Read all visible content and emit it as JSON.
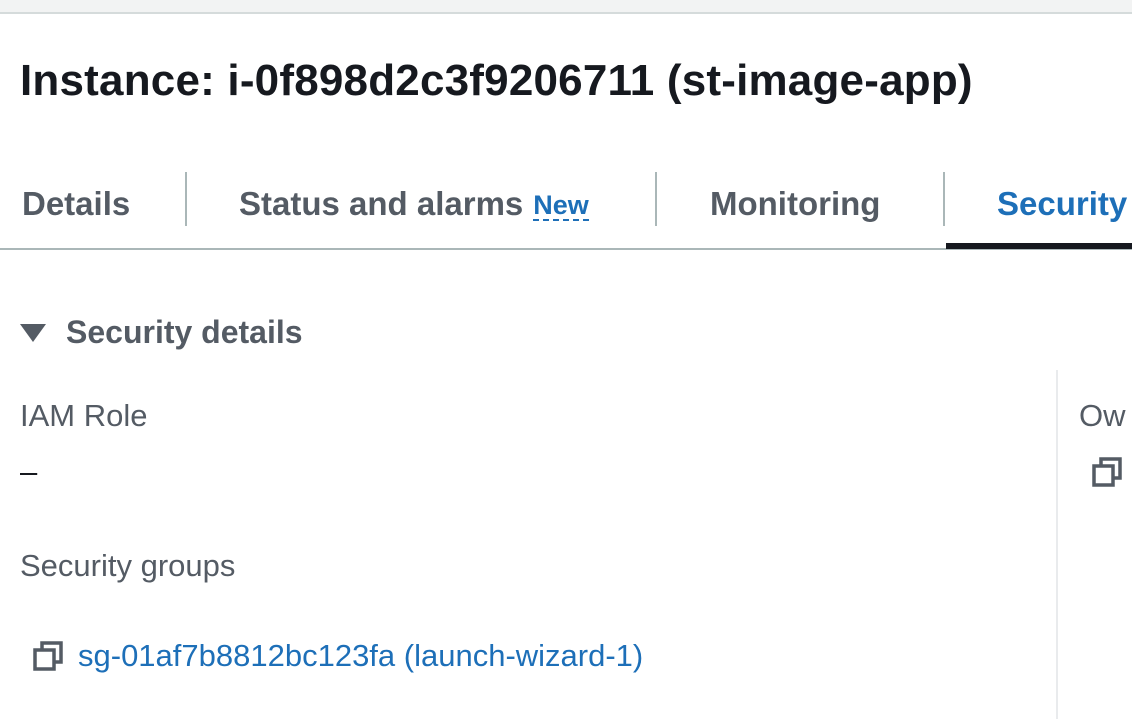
{
  "header": {
    "title": "Instance: i-0f898d2c3f9206711 (st-image-app)"
  },
  "tabs": [
    {
      "label": "Details"
    },
    {
      "label": "Status and alarms",
      "badge": "New"
    },
    {
      "label": "Monitoring"
    },
    {
      "label": "Security",
      "active": true
    }
  ],
  "security_details": {
    "title": "Security details",
    "iam_role": {
      "label": "IAM Role",
      "value": "–"
    },
    "security_groups": {
      "label": "Security groups",
      "items": [
        "sg-01af7b8812bc123fa (launch-wizard-1)"
      ]
    },
    "owner": {
      "label": "Ow"
    }
  },
  "icons": {
    "caret": "caret-down-icon",
    "copy": "copy-icon"
  },
  "colors": {
    "link": "#1d6fb8",
    "active_tab_underline": "#16191f",
    "muted_text": "#545b64"
  }
}
